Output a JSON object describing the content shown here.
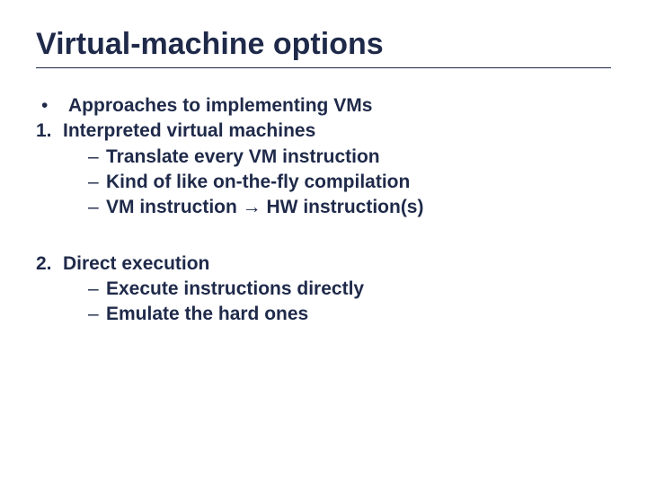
{
  "title": "Virtual-machine options",
  "bullet1": "Approaches to implementing VMs",
  "num1": "1.",
  "item1": "Interpreted virtual machines",
  "sub1a": "Translate every VM instruction",
  "sub1b": "Kind of like on-the-fly compilation",
  "sub1c": "VM instruction → HW instruction(s)",
  "num2": "2.",
  "item2": "Direct execution",
  "sub2a": "Execute instructions directly",
  "sub2b": "Emulate the hard ones",
  "dot": "•",
  "dash": "–"
}
